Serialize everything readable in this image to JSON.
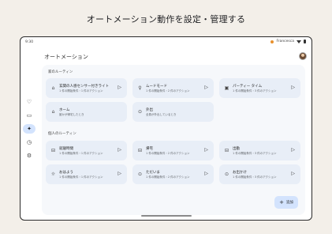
{
  "headline": "オートメーション動作を設定・管理する",
  "status": {
    "time": "9:30",
    "account": "Francesca"
  },
  "page_title": "オートメーション",
  "rail": {
    "items": [
      "favorites",
      "devices",
      "automations",
      "activity",
      "settings"
    ]
  },
  "household": {
    "label": "家のルーティン",
    "cards": [
      {
        "icon": "home-icon",
        "name": "玄関の人感センサー付きライト",
        "sub": "1 件の開始条件・1 件のアクション",
        "playable": true
      },
      {
        "icon": "bulb-icon",
        "name": "ムードモード",
        "sub": "1 件の開始条件・2 件のアクション",
        "playable": true
      },
      {
        "icon": "party-icon",
        "name": "パーティー タイム",
        "sub": "1 件の開始条件・3 件のアクション",
        "playable": true
      },
      {
        "icon": "house-icon",
        "name": "ホーム",
        "sub": "誰かが帰宅したとき",
        "playable": false
      },
      {
        "icon": "away-icon",
        "name": "外出",
        "sub": "全員が外出しているとき",
        "playable": false
      }
    ]
  },
  "personal": {
    "label": "個人のルーティン",
    "cards": [
      {
        "icon": "car-icon",
        "name": "就寝時間",
        "sub": "1 件の開始条件・1 件のアクション",
        "playable": true
      },
      {
        "icon": "car-icon",
        "name": "帰宅",
        "sub": "1 件の開始条件・2 件のアクション",
        "playable": true
      },
      {
        "icon": "car-icon",
        "name": "出勤",
        "sub": "1 件の開始条件・3 件のアクション",
        "playable": true
      },
      {
        "icon": "sun-icon",
        "name": "おはよう",
        "sub": "1 件の開始条件・1 件のアクション",
        "playable": true
      },
      {
        "icon": "pin-icon",
        "name": "ただいま",
        "sub": "1 件の開始条件・2 件のアクション",
        "playable": true
      },
      {
        "icon": "pin-icon",
        "name": "お出かけ",
        "sub": "1 件の開始条件・3 件のアクション",
        "playable": true
      }
    ]
  },
  "fab": {
    "label": "追加"
  }
}
